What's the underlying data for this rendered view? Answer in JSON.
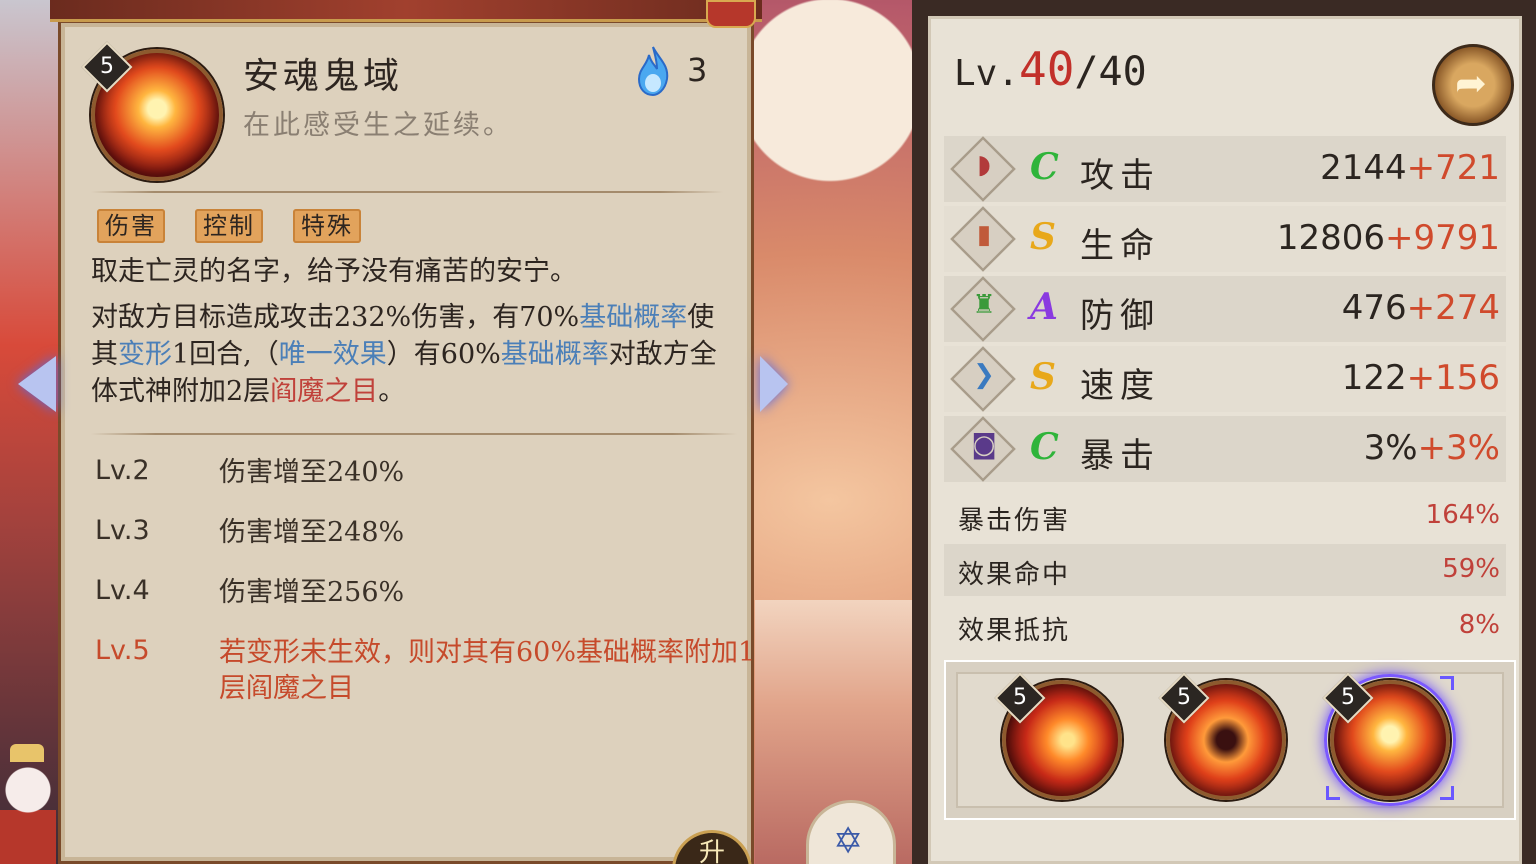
{
  "skill": {
    "level": "5",
    "name": "安魂鬼域",
    "subtitle": "在此感受生之延续。",
    "cost": "3",
    "tags": [
      "伤害",
      "控制",
      "特殊"
    ],
    "flavor": "取走亡灵的名字，给予没有痛苦的安宁。",
    "description": {
      "p1": "对敌方目标造成攻击232%伤害，有70%",
      "kw_basic_rate": "基础概率",
      "p2": "使其",
      "kw_transform": "变形",
      "p3": "1回合,（",
      "kw_unique": "唯一效果",
      "p4": "）有60%",
      "kw_basic_rate_2": "基础概率",
      "p5": "对敌方全体式神附加2层",
      "kw_yama_eye": "阎魔之目",
      "p6": "。"
    },
    "upgrades": [
      {
        "lv": "Lv.2",
        "text": "伤害增至240%"
      },
      {
        "lv": "Lv.3",
        "text": "伤害增至248%"
      },
      {
        "lv": "Lv.4",
        "text": "伤害增至256%"
      },
      {
        "lv": "Lv.5",
        "text": "若变形未生效，则对其有60%基础概率附加1层阎魔之目"
      }
    ]
  },
  "stats_panel": {
    "level_prefix": "Lv.",
    "level_current": "40",
    "level_max": "/40",
    "main_stats": [
      {
        "grade": "C",
        "grade_color": "#2fb43a",
        "icon": "fan-icon",
        "name": "攻击",
        "base": "2144",
        "bonus": "+721"
      },
      {
        "grade": "S",
        "grade_color": "#e8a81a",
        "icon": "talisman-icon",
        "name": "生命",
        "base": "12806",
        "bonus": "+9791"
      },
      {
        "grade": "A",
        "grade_color": "#8a3ae0",
        "icon": "armor-icon",
        "name": "防御",
        "base": "476",
        "bonus": "+274"
      },
      {
        "grade": "S",
        "grade_color": "#e8a81a",
        "icon": "speed-chevron-icon",
        "name": "速度",
        "base": "122",
        "bonus": "+156"
      },
      {
        "grade": "C",
        "grade_color": "#2fb43a",
        "icon": "scroll-icon",
        "name": "暴击",
        "base": "3%",
        "bonus": "+3%"
      }
    ],
    "sub_stats": [
      {
        "name": "暴击伤害",
        "value": "164%"
      },
      {
        "name": "效果命中",
        "value": "59%"
      },
      {
        "name": "效果抵抗",
        "value": "8%"
      }
    ],
    "skill_slots": [
      {
        "level": "5",
        "icon": "fire-skill-1-icon",
        "selected": false
      },
      {
        "level": "5",
        "icon": "fire-skill-2-icon",
        "selected": false
      },
      {
        "level": "5",
        "icon": "fire-skill-3-icon",
        "selected": true
      }
    ]
  },
  "bottom": {
    "upgrade_label": "升"
  },
  "colors": {
    "bonus": "#d04a2c",
    "keyword_blue": "#4b7fb8",
    "keyword_red": "#c0413a",
    "selected_glow": "#6a4aff"
  }
}
